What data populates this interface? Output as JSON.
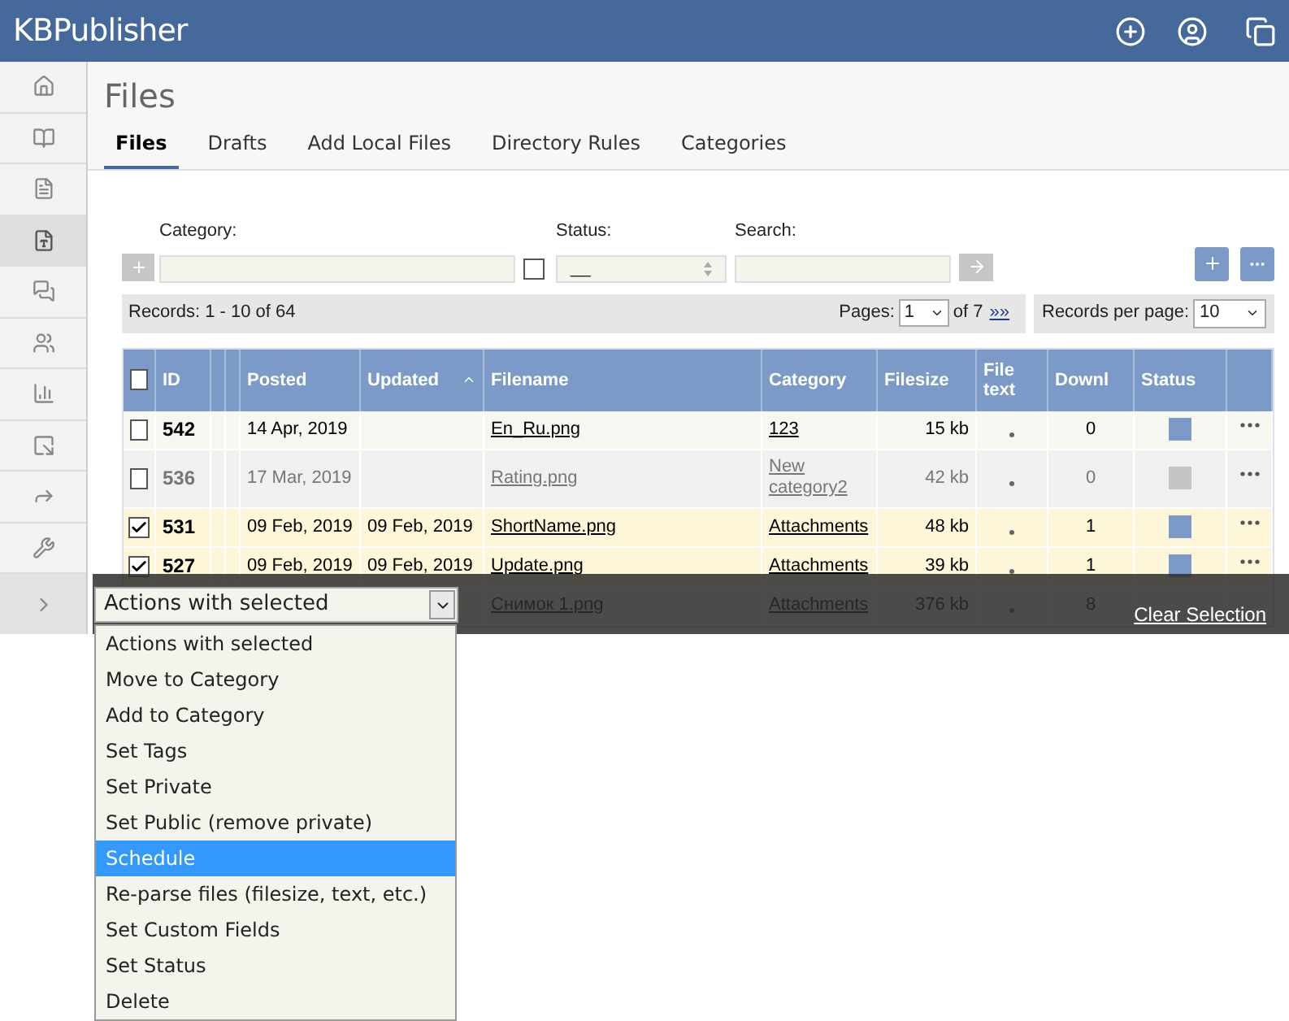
{
  "header": {
    "title": "KBPublisher"
  },
  "sidebar": {
    "items": [
      {
        "kind": "home",
        "selected": false
      },
      {
        "kind": "book",
        "selected": false
      },
      {
        "kind": "document",
        "selected": false
      },
      {
        "kind": "pdf",
        "selected": true
      },
      {
        "kind": "chat",
        "selected": false
      },
      {
        "kind": "users",
        "selected": false
      },
      {
        "kind": "chart",
        "selected": false
      },
      {
        "kind": "box",
        "selected": false
      },
      {
        "kind": "share",
        "selected": false
      },
      {
        "kind": "wrench",
        "selected": false
      },
      {
        "kind": "expand",
        "selected": false
      }
    ]
  },
  "page": {
    "title": "Files"
  },
  "tabs": [
    {
      "label": "Files",
      "selected": true
    },
    {
      "label": "Drafts",
      "selected": false
    },
    {
      "label": "Add Local Files",
      "selected": false
    },
    {
      "label": "Directory Rules",
      "selected": false
    },
    {
      "label": "Categories",
      "selected": false
    }
  ],
  "filters": {
    "category_label": "Category:",
    "status_label": "Status:",
    "status_value": "__",
    "search_label": "Search:",
    "checked": false
  },
  "records": {
    "text": "Records: 1 - 10 of 64",
    "pages_label": "Pages:",
    "page": "1",
    "of_pages": "of 7",
    "next": "»»",
    "per_page_label": "Records per page:",
    "per_page": "10"
  },
  "table": {
    "all_checked": false,
    "columns": [
      "ID",
      "Posted",
      "Updated",
      "Filename",
      "Category",
      "Filesize",
      "File text",
      "Downl",
      "Status"
    ],
    "rows": [
      {
        "id": "542",
        "posted": "14 Apr, 2019",
        "filename": "En_Ru.png",
        "category": "123",
        "filesize": "15 kb",
        "downloads": "0",
        "color": "#7b9ac7",
        "checked": false,
        "inactive": false
      },
      {
        "id": "536",
        "posted": "17 Mar, 2019",
        "filename": "Rating.png",
        "category": "New category2",
        "filesize": "42 kb",
        "downloads": "0",
        "color": "#c4c4c4",
        "checked": false,
        "inactive": true
      },
      {
        "id": "531",
        "posted": "09 Feb, 2019",
        "updated": "09 Feb, 2019",
        "filename": "ShortName.png",
        "category": "Attachments",
        "filesize": "48 kb",
        "downloads": "1",
        "color": "#7b9ac7",
        "checked": true,
        "inactive": false
      },
      {
        "id": "527",
        "posted": "09 Feb, 2019",
        "updated": "09 Feb, 2019",
        "filename": "Update.png",
        "category": "Attachments",
        "filesize": "39 kb",
        "downloads": "1",
        "color": "#7b9ac7",
        "checked": true,
        "inactive": false
      },
      {
        "filename": "Снимок 1.png",
        "category": "Attachments",
        "filesize": "376 kb",
        "downloads": "8"
      }
    ]
  },
  "action_bar": {
    "select": "Actions with selected",
    "clear": "Clear Selection",
    "options": [
      {
        "label": "Actions with selected",
        "selected": false
      },
      {
        "label": "Move to Category",
        "selected": false
      },
      {
        "label": "Add to Category",
        "selected": false
      },
      {
        "label": "Set Tags",
        "selected": false
      },
      {
        "label": "Set Private",
        "selected": false
      },
      {
        "label": "Set Public (remove private)",
        "selected": false
      },
      {
        "label": "Schedule",
        "selected": true
      },
      {
        "label": "Re-parse files (filesize, text, etc.)",
        "selected": false
      },
      {
        "label": "Set Custom Fields",
        "selected": false
      },
      {
        "label": "Set Status",
        "selected": false
      },
      {
        "label": "Delete",
        "selected": false
      }
    ]
  }
}
